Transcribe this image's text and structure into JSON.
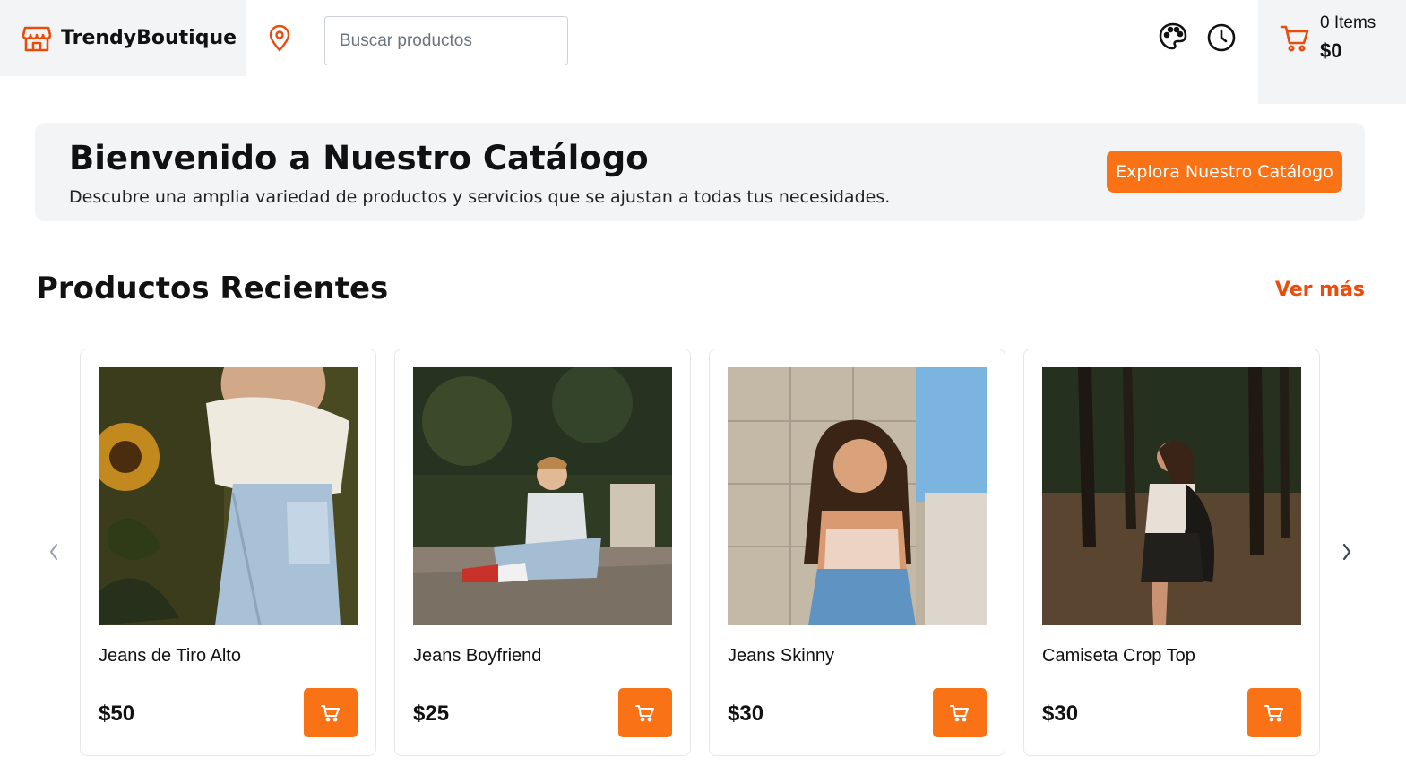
{
  "header": {
    "brand_name": "TrendyBoutique",
    "brand_icon": "store-icon",
    "location_icon": "map-pin-icon",
    "search_placeholder": "Buscar productos",
    "theme_icon": "palette-icon",
    "history_icon": "clock-icon",
    "cart": {
      "icon": "cart-icon",
      "items_label": "0 Items",
      "total": "$0"
    }
  },
  "hero": {
    "title": "Bienvenido a Nuestro Catálogo",
    "subtitle": "Descubre una amplia variedad de productos y servicios que se ajustan a todas tus necesidades.",
    "cta_label": "Explora Nuestro Catálogo"
  },
  "recent": {
    "title": "Productos Recientes",
    "see_more": "Ver más",
    "products": [
      {
        "name": "Jeans de Tiro Alto",
        "price": "$50"
      },
      {
        "name": "Jeans Boyfriend",
        "price": "$25"
      },
      {
        "name": "Jeans Skinny",
        "price": "$30"
      },
      {
        "name": "Camiseta Crop Top",
        "price": "$30"
      }
    ]
  },
  "colors": {
    "accent": "#f97316",
    "link": "#ea4c0c",
    "panel_bg": "#f3f4f6"
  }
}
